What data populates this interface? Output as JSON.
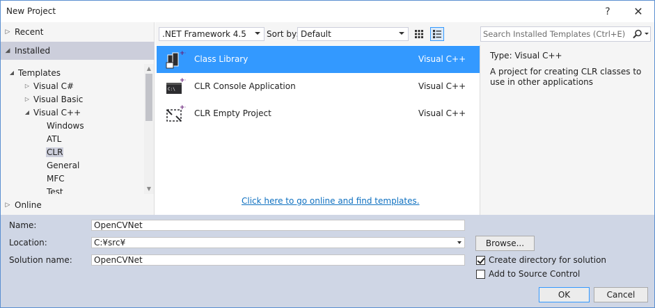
{
  "window": {
    "title": "New Project",
    "help_glyph": "?",
    "close_glyph": "✕"
  },
  "left_pane": {
    "recent": "Recent",
    "installed": "Installed",
    "online": "Online",
    "tree": [
      {
        "label": "Templates",
        "indent": 0,
        "expander": "expanded"
      },
      {
        "label": "Visual C#",
        "indent": 1,
        "expander": "collapsed"
      },
      {
        "label": "Visual Basic",
        "indent": 1,
        "expander": "collapsed"
      },
      {
        "label": "Visual C++",
        "indent": 1,
        "expander": "expanded"
      },
      {
        "label": "Windows",
        "indent": 2,
        "expander": "none"
      },
      {
        "label": "ATL",
        "indent": 2,
        "expander": "none"
      },
      {
        "label": "CLR",
        "indent": 2,
        "expander": "none",
        "selected": true
      },
      {
        "label": "General",
        "indent": 2,
        "expander": "none"
      },
      {
        "label": "MFC",
        "indent": 2,
        "expander": "none"
      },
      {
        "label": "Test",
        "indent": 2,
        "expander": "none"
      }
    ]
  },
  "toolbar": {
    "framework": ".NET Framework 4.5",
    "sort_label": "Sort by:",
    "sort_value": "Default"
  },
  "search": {
    "placeholder": "Search Installed Templates (Ctrl+E)"
  },
  "templates": [
    {
      "name": "Class Library",
      "language": "Visual C++",
      "icon": "class-library-icon",
      "selected": true
    },
    {
      "name": "CLR Console Application",
      "language": "Visual C++",
      "icon": "console-app-icon",
      "selected": false
    },
    {
      "name": "CLR Empty Project",
      "language": "Visual C++",
      "icon": "empty-project-icon",
      "selected": false
    }
  ],
  "online_link": "Click here to go online and find templates.",
  "description": {
    "type_label": "Type:",
    "type_value": "Visual C++",
    "text": "A project for creating CLR classes to use in other applications"
  },
  "form": {
    "name_label": "Name:",
    "name_value": "OpenCVNet",
    "location_label": "Location:",
    "location_value": "C:¥src¥",
    "solution_label": "Solution name:",
    "solution_value": "OpenCVNet",
    "browse_label": "Browse...",
    "create_dir_label": "Create directory for solution",
    "create_dir_checked": true,
    "source_control_label": "Add to Source Control",
    "source_control_checked": false,
    "ok_label": "OK",
    "cancel_label": "Cancel"
  },
  "colors": {
    "accent": "#3399ff",
    "selected_tree": "#cccedb",
    "link": "#0e70c0",
    "bottom_bg": "#cfd6e5"
  }
}
